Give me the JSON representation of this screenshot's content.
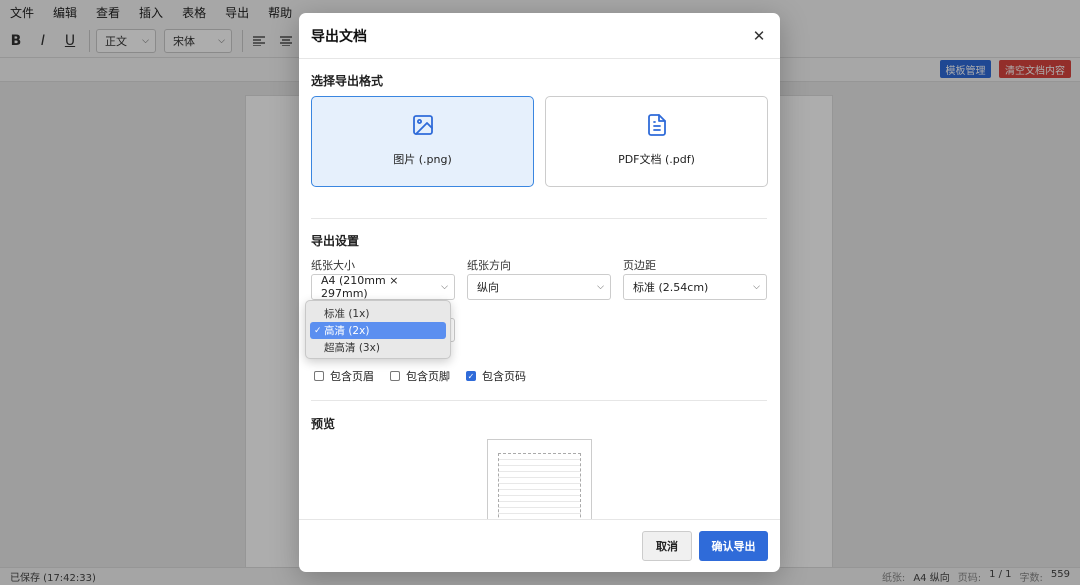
{
  "menu": [
    "文件",
    "编辑",
    "查看",
    "插入",
    "表格",
    "导出",
    "帮助"
  ],
  "toolbar": {
    "bold": "B",
    "italic": "I",
    "underline": "U",
    "style_select": "正文",
    "font_select": "宋体"
  },
  "subbar": {
    "template_btn": "模板管理",
    "clear_btn": "清空文档内容"
  },
  "status": {
    "saved": "已保存 (17:42:33)",
    "paper_label": "纸张:",
    "paper_value": "A4 纵向",
    "page_label": "页码:",
    "page_value": "1 / 1",
    "words_label": "字数:",
    "words_value": "559"
  },
  "modal": {
    "title": "导出文档",
    "close": "✕",
    "format_section": "选择导出格式",
    "formats": [
      {
        "label": "图片 (.png)",
        "icon": "image-icon",
        "selected": true
      },
      {
        "label": "PDF文档 (.pdf)",
        "icon": "document-icon",
        "selected": false
      }
    ],
    "settings_section": "导出设置",
    "paper_size": {
      "label": "纸张大小",
      "value": "A4 (210mm × 297mm)"
    },
    "orientation": {
      "label": "纸张方向",
      "value": "纵向"
    },
    "margin": {
      "label": "页边距",
      "value": "标准 (2.54cm)"
    },
    "quality_options": [
      "标准 (1x)",
      "高清 (2x)",
      "超高清 (3x)"
    ],
    "quality_selected": "高清 (2x)",
    "checkboxes": [
      {
        "label": "包含页眉",
        "checked": false
      },
      {
        "label": "包含页脚",
        "checked": false
      },
      {
        "label": "包含页码",
        "checked": true
      }
    ],
    "preview_section": "预览",
    "cancel": "取消",
    "confirm": "确认导出"
  },
  "colors": {
    "accent": "#2f6bd9",
    "selected_card_bg": "#e6f0fc",
    "danger": "#d9453f"
  }
}
